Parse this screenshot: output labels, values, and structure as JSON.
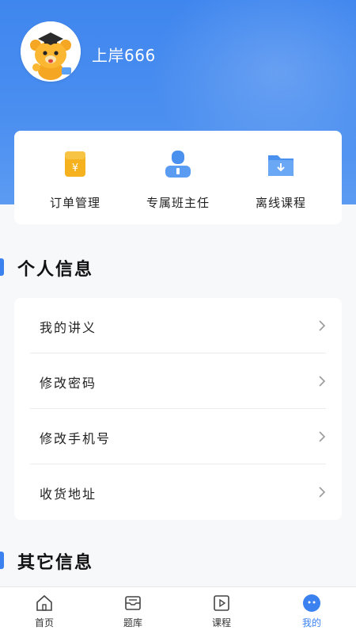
{
  "profile": {
    "username": "上岸666"
  },
  "shortcuts": [
    {
      "label": "订单管理",
      "icon": "yen-card-icon"
    },
    {
      "label": "专属班主任",
      "icon": "advisor-icon"
    },
    {
      "label": "离线课程",
      "icon": "download-folder-icon"
    }
  ],
  "personal": {
    "title": "个人信息",
    "items": [
      {
        "label": "我的讲义"
      },
      {
        "label": "修改密码"
      },
      {
        "label": "修改手机号"
      },
      {
        "label": "收货地址"
      }
    ]
  },
  "other": {
    "title": "其它信息"
  },
  "tabbar": {
    "items": [
      {
        "label": "首页",
        "icon": "home-icon"
      },
      {
        "label": "题库",
        "icon": "question-bank-icon"
      },
      {
        "label": "课程",
        "icon": "course-icon"
      },
      {
        "label": "我的",
        "icon": "profile-icon"
      }
    ],
    "active_index": 3
  },
  "colors": {
    "primary": "#3b82f0",
    "hero": "#4a8ef0",
    "card_icon_gold": "#f5b21e"
  }
}
